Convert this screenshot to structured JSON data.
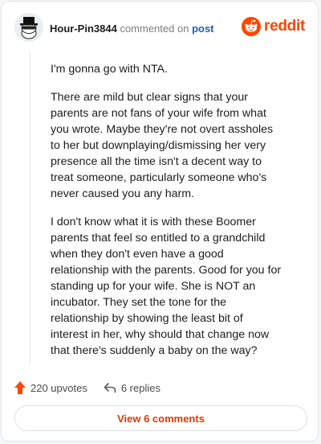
{
  "header": {
    "username": "Hour-Pin3844",
    "commented_text": "commented on",
    "post_link": "post",
    "brand": "reddit",
    "brand_color": "#ff4500"
  },
  "comment": {
    "paragraphs": [
      "I'm gonna go with NTA.",
      "There are mild but clear signs that your parents are not fans of your wife from what you wrote. Maybe they're not overt assholes to her but downplaying/dismissing her very presence all the time isn't a decent way to treat someone, particularly someone who's never caused you any harm.",
      "I don't know what it is with these Boomer parents that feel so entitled to a grandchild when they don't even have a good relationship with the parents. Good for you for standing up for your wife. She is NOT an incubator. They set the tone for the relationship by showing the least bit of interest in her, why should that change now that there's suddenly a baby on the way?"
    ]
  },
  "actions": {
    "upvotes": "220 upvotes",
    "replies": "6 replies",
    "upvote_icon": "upvote-arrow-icon",
    "reply_icon": "reply-icon"
  },
  "footer": {
    "view_button": "View 6 comments"
  }
}
